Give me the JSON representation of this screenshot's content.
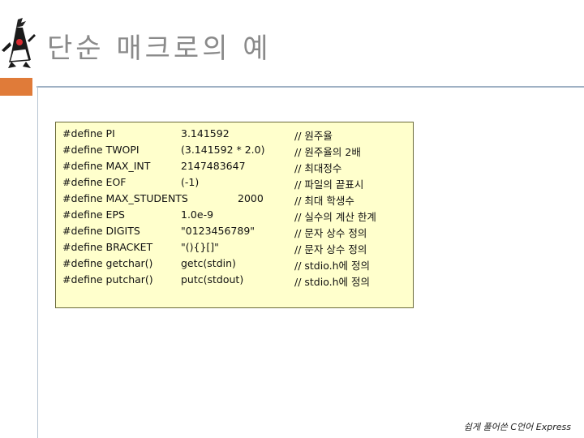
{
  "slide": {
    "title": "단순 매크로의 예",
    "footer": "쉽게 풀어쓴 C언어 Express"
  },
  "code_lines": [
    {
      "name": "#define PI",
      "value": "3.141592",
      "comment": "// 원주율"
    },
    {
      "name": "#define TWOPI",
      "value": "(3.141592 * 2.0)",
      "comment": "// 원주율의 2배"
    },
    {
      "name": "#define MAX_INT",
      "value": "2147483647",
      "comment": "// 최대정수"
    },
    {
      "name": "#define EOF",
      "value": "(-1)",
      "comment": "// 파일의 끝표시"
    },
    {
      "name": "#define MAX_STUDENTS",
      "value": "2000",
      "comment": "// 최대 학생수"
    },
    {
      "name": "#define EPS",
      "value": "1.0e-9",
      "comment": "// 실수의 계산 한계"
    },
    {
      "name": "#define DIGITS",
      "value": "\"0123456789\"",
      "comment": "// 문자 상수 정의"
    },
    {
      "name": "#define BRACKET",
      "value": "\"(){}[]\"",
      "comment": "// 문자 상수 정의"
    },
    {
      "name": "#define getchar()",
      "value": "getc(stdin)",
      "comment": "// stdio.h에 정의"
    },
    {
      "name": "#define putchar()",
      "value": "putc(stdout)",
      "comment": "// stdio.h에 정의"
    }
  ],
  "colors": {
    "accent": "#e07b39",
    "code_background": "#ffffcc",
    "title": "#8a8a8a"
  },
  "icons": {
    "logo": "java-duke-mascot-icon"
  }
}
